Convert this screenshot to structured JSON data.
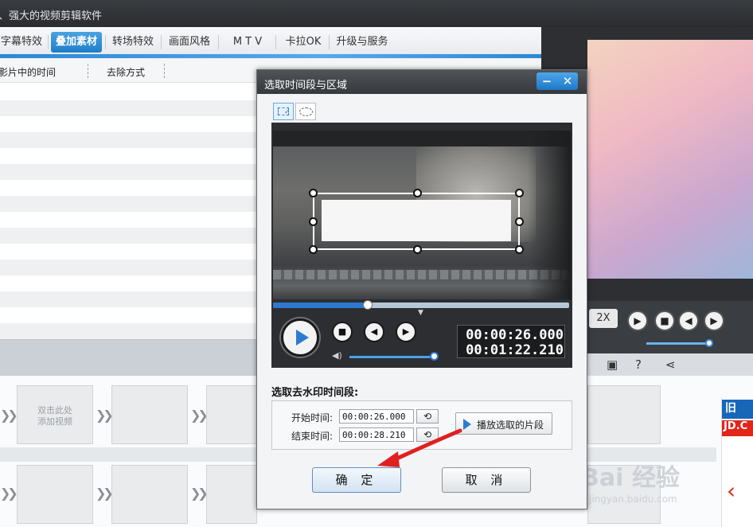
{
  "app": {
    "title": "、强大的视频剪辑软件"
  },
  "tabs": [
    {
      "label": "字幕特效"
    },
    {
      "label": "叠加素材"
    },
    {
      "label": "转场特效"
    },
    {
      "label": "画面风格"
    },
    {
      "label": "M T V"
    },
    {
      "label": "卡拉OK"
    },
    {
      "label": "升级与服务"
    }
  ],
  "table": {
    "columns": [
      "影片中的时间",
      "去除方式"
    ]
  },
  "timeline": {
    "add_video_hint": "双击此处\n添加视频"
  },
  "preview": {
    "speed": "2X"
  },
  "dialog": {
    "title": "选取时间段与区域",
    "current_time": "00:00:26.000",
    "total_time": "00:01:22.210",
    "section_label": "选取去水印时间段:",
    "start_label": "开始时间:",
    "start_value": "00:00:26.000",
    "end_label": "结束时间:",
    "end_value": "00:00:28.210",
    "play_selected": "播放选取的片段",
    "ok": "确 定",
    "cancel": "取 消"
  },
  "ad": {
    "brand_top": "旧",
    "brand_mid": "JD.C"
  },
  "watermark": {
    "main": "Bai 经验",
    "sub": "jingyan.baidu.com"
  },
  "colors": {
    "accent": "#2c7bd0",
    "arrow": "#e02020"
  }
}
